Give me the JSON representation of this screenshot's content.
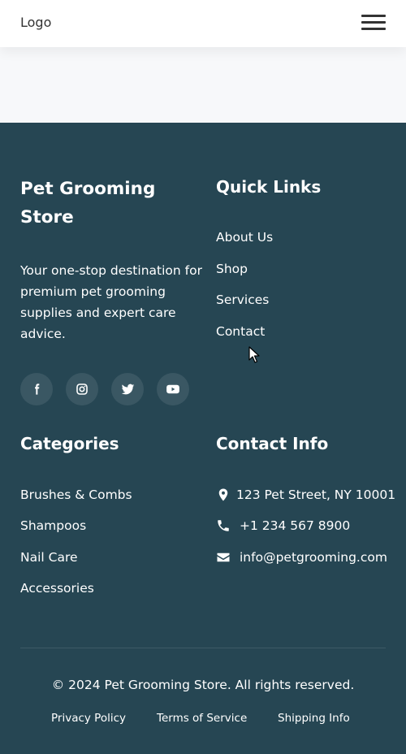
{
  "header": {
    "logo": "Logo",
    "menu_icon": "hamburger-menu-icon"
  },
  "footer": {
    "brand": {
      "title": "Pet Grooming Store",
      "description": "Your one-stop destination for premium pet grooming supplies and expert care advice."
    },
    "socials": [
      {
        "icon": "facebook-icon"
      },
      {
        "icon": "instagram-icon"
      },
      {
        "icon": "twitter-icon"
      },
      {
        "icon": "youtube-icon"
      }
    ],
    "quick_links": {
      "title": "Quick Links",
      "items": [
        "About Us",
        "Shop",
        "Services",
        "Contact"
      ]
    },
    "categories": {
      "title": "Categories",
      "items": [
        "Brushes & Combs",
        "Shampoos",
        "Nail Care",
        "Accessories"
      ]
    },
    "contact": {
      "title": "Contact Info",
      "address": "123 Pet Street, NY 10001",
      "phone": "+1 234 567 8900",
      "email": "info@petgrooming.com"
    },
    "copyright": "© 2024 Pet Grooming Store. All rights reserved.",
    "legal_links": [
      "Privacy Policy",
      "Terms of Service",
      "Shipping Info"
    ]
  },
  "colors": {
    "footer_bg": "#264653",
    "social_bg": "#3a5763",
    "page_bg": "#f7f8fa"
  }
}
